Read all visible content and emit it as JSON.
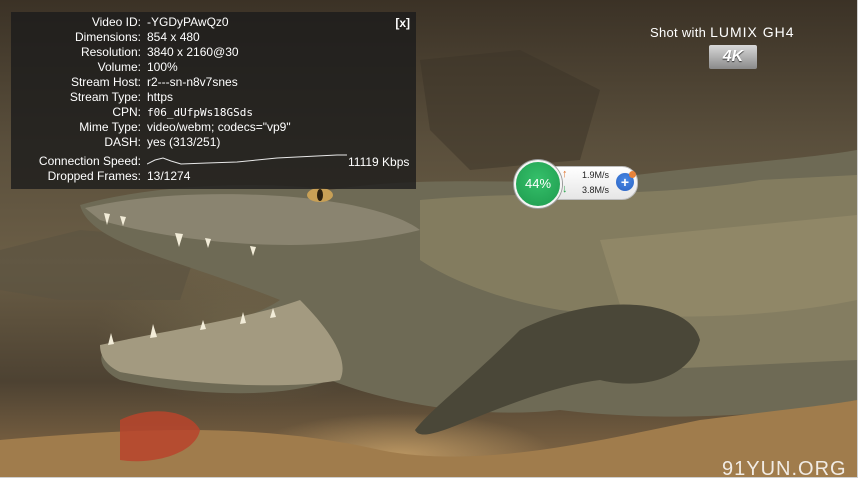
{
  "stats": {
    "close_label": "[x]",
    "rows": [
      {
        "label": "Video ID:",
        "value": "-YGDyPAwQz0"
      },
      {
        "label": "Dimensions:",
        "value": "854 x 480"
      },
      {
        "label": "Resolution:",
        "value": "3840 x 2160@30"
      },
      {
        "label": "Volume:",
        "value": "100%"
      },
      {
        "label": "Stream Host:",
        "value": "r2---sn-n8v7snes"
      },
      {
        "label": "Stream Type:",
        "value": "https"
      },
      {
        "label": "CPN:",
        "value": "f06_dUfpWs18GSds"
      },
      {
        "label": "Mime Type:",
        "value": "video/webm; codecs=\"vp9\""
      },
      {
        "label": "DASH:",
        "value": "yes (313/251)"
      }
    ],
    "connection_label": "Connection Speed:",
    "connection_value": "11119 Kbps",
    "dropped_label": "Dropped Frames:",
    "dropped_value": "13/1274"
  },
  "camera": {
    "prefix": "Shot with",
    "model": "LUMIX GH4",
    "badge": "4K"
  },
  "network": {
    "percent": "44%",
    "upload": "1.9M/s",
    "download": "3.8M/s",
    "up_arrow": "↑",
    "down_arrow": "↓",
    "plus": "+"
  },
  "site": "91YUN.ORG",
  "icons": {
    "close": "close-icon",
    "upload": "upload-arrow-icon",
    "download": "download-arrow-icon",
    "add": "plus-icon"
  },
  "colors": {
    "overlay": "#1c1c1c",
    "accent_green": "#1e9a4e",
    "accent_blue": "#2a62c2",
    "accent_orange": "#e0722a"
  }
}
